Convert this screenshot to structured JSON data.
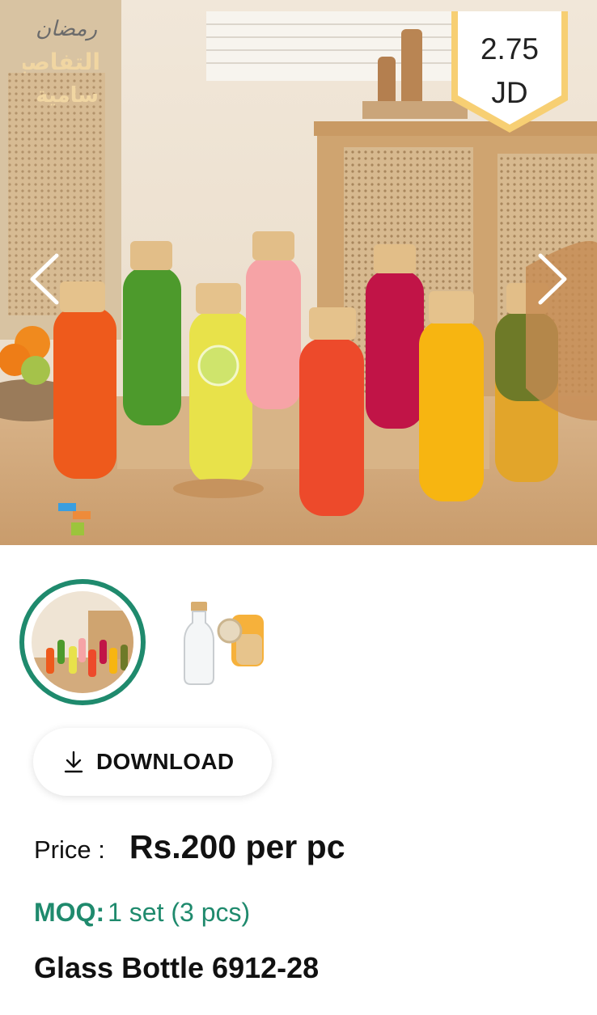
{
  "hero": {
    "price_tag": {
      "amount": "2.75",
      "currency": "JD"
    },
    "watermark_text": "رمضان التفاصيل مع سامية"
  },
  "gallery": {
    "thumbnails": [
      {
        "label": "Bottles lineup",
        "selected": true
      },
      {
        "label": "Single bottle with lid",
        "selected": false
      }
    ]
  },
  "download": {
    "label": "DOWNLOAD",
    "icon": "download-icon"
  },
  "product": {
    "price_label": "Price :",
    "price_value": "Rs.200 per pc",
    "moq_label": "MOQ:",
    "moq_value": "1 set (3 pcs)",
    "title": "Glass Bottle 6912-28"
  },
  "colors": {
    "accent": "#1f8a6d",
    "text": "#111111",
    "price_tag_bg": "#f7cf73"
  }
}
